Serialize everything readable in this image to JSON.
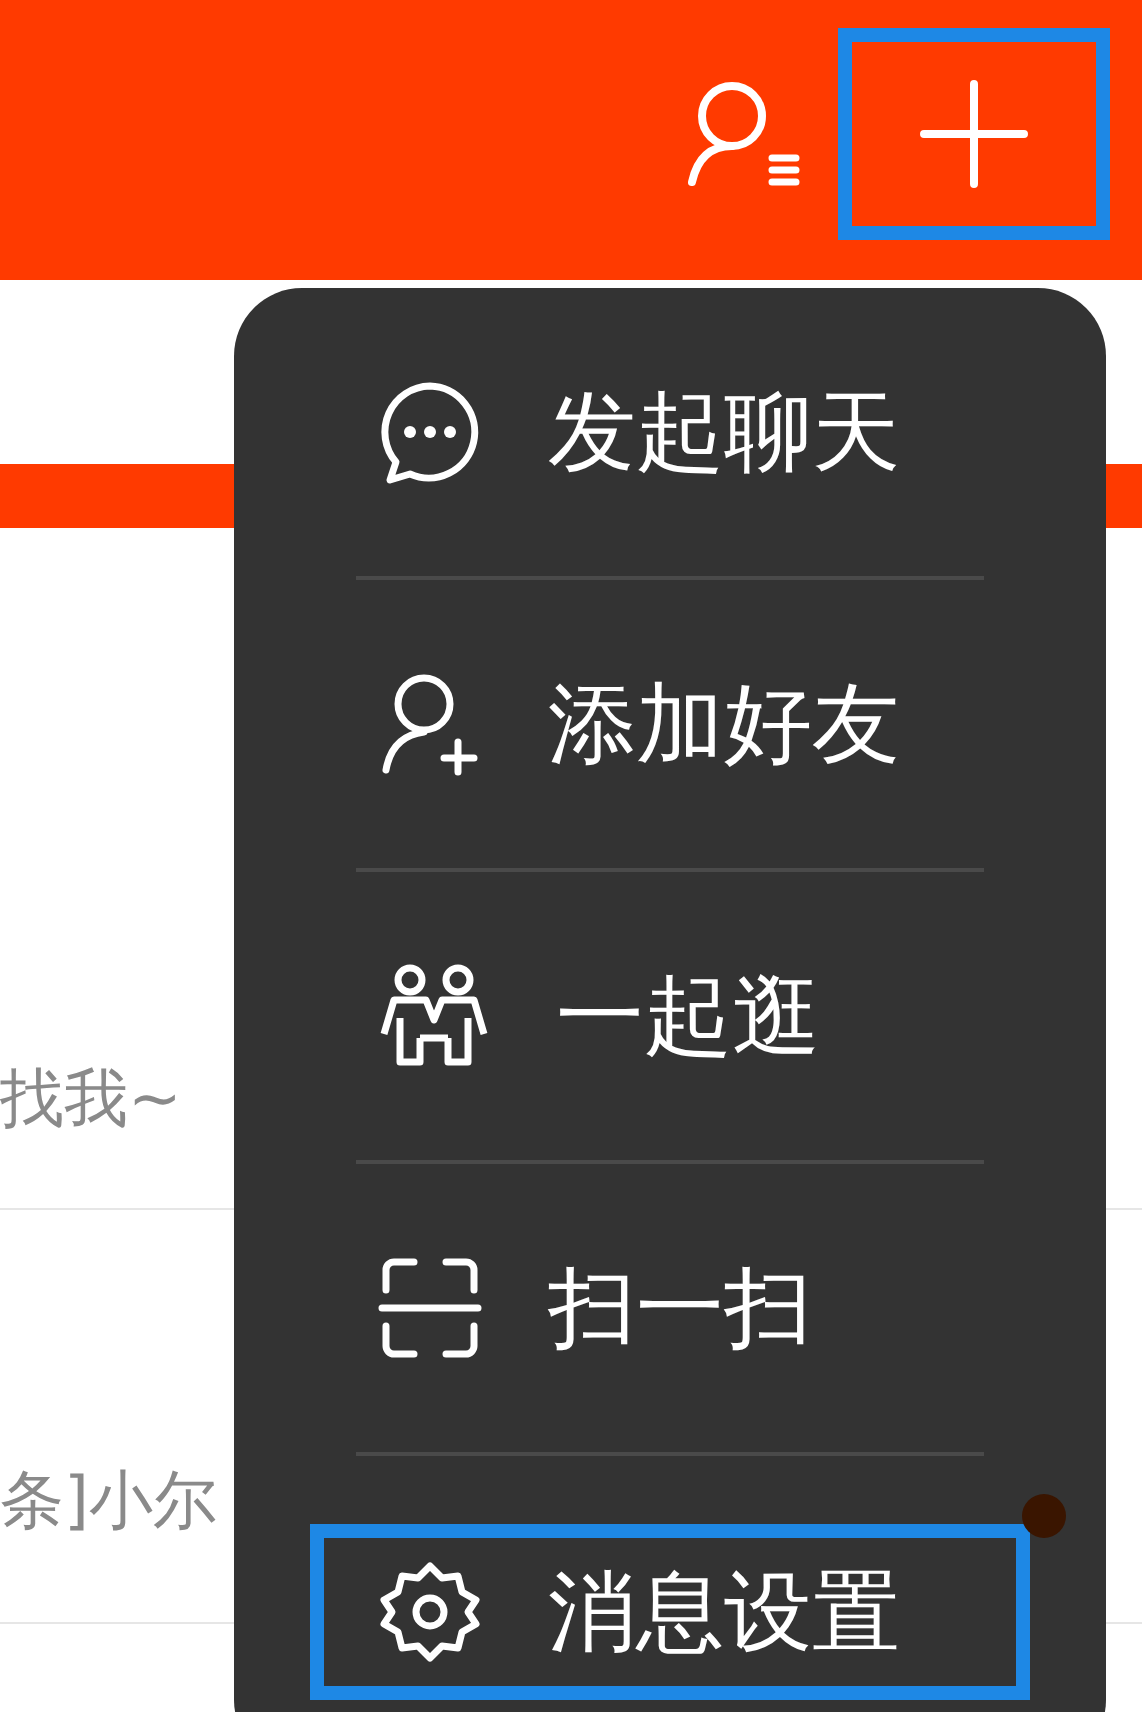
{
  "header": {
    "buttons": [
      {
        "kind": "contacts",
        "highlighted": false
      },
      {
        "kind": "add",
        "highlighted": true
      }
    ]
  },
  "list": {
    "rows": [
      {
        "preview": "找我~",
        "unread": false
      },
      {
        "preview": "条]小尔",
        "unread": true
      }
    ]
  },
  "menu": {
    "items": [
      {
        "kind": "chat",
        "label": "发起聊天",
        "highlighted": false
      },
      {
        "kind": "add-friend",
        "label": "添加好友",
        "highlighted": false
      },
      {
        "kind": "together",
        "label": "一起逛",
        "highlighted": false
      },
      {
        "kind": "scan",
        "label": "扫一扫",
        "highlighted": false
      },
      {
        "kind": "settings",
        "label": "消息设置",
        "highlighted": true
      }
    ]
  }
}
